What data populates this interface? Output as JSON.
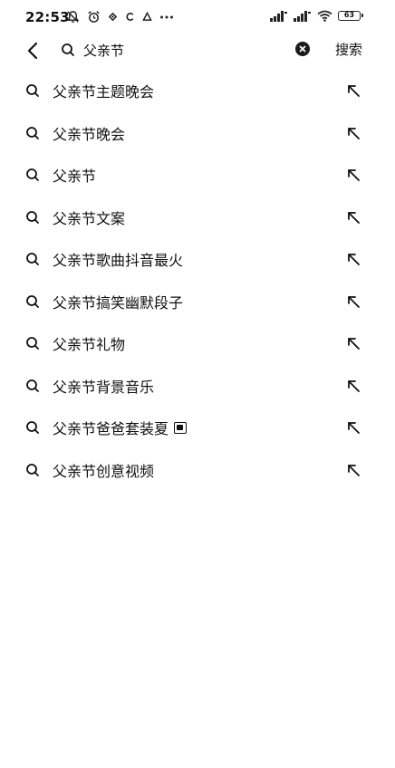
{
  "status_bar": {
    "time": "22:53",
    "battery": "63"
  },
  "search": {
    "query": "父亲节",
    "search_button_label": "搜索"
  },
  "suggestions": [
    {
      "text": "父亲节主题晚会",
      "has_tag_icon": false
    },
    {
      "text": "父亲节晚会",
      "has_tag_icon": false
    },
    {
      "text": "父亲节",
      "has_tag_icon": false
    },
    {
      "text": "父亲节文案",
      "has_tag_icon": false
    },
    {
      "text": "父亲节歌曲抖音最火",
      "has_tag_icon": false
    },
    {
      "text": "父亲节搞笑幽默段子",
      "has_tag_icon": false
    },
    {
      "text": "父亲节礼物",
      "has_tag_icon": false
    },
    {
      "text": "父亲节背景音乐",
      "has_tag_icon": false
    },
    {
      "text": "父亲节爸爸套装夏",
      "has_tag_icon": true
    },
    {
      "text": "父亲节创意视频",
      "has_tag_icon": false
    }
  ],
  "icons": {
    "back": "chevron-left-icon",
    "search": "search-icon",
    "clear": "clear-icon",
    "fill": "arrow-up-left-icon"
  }
}
